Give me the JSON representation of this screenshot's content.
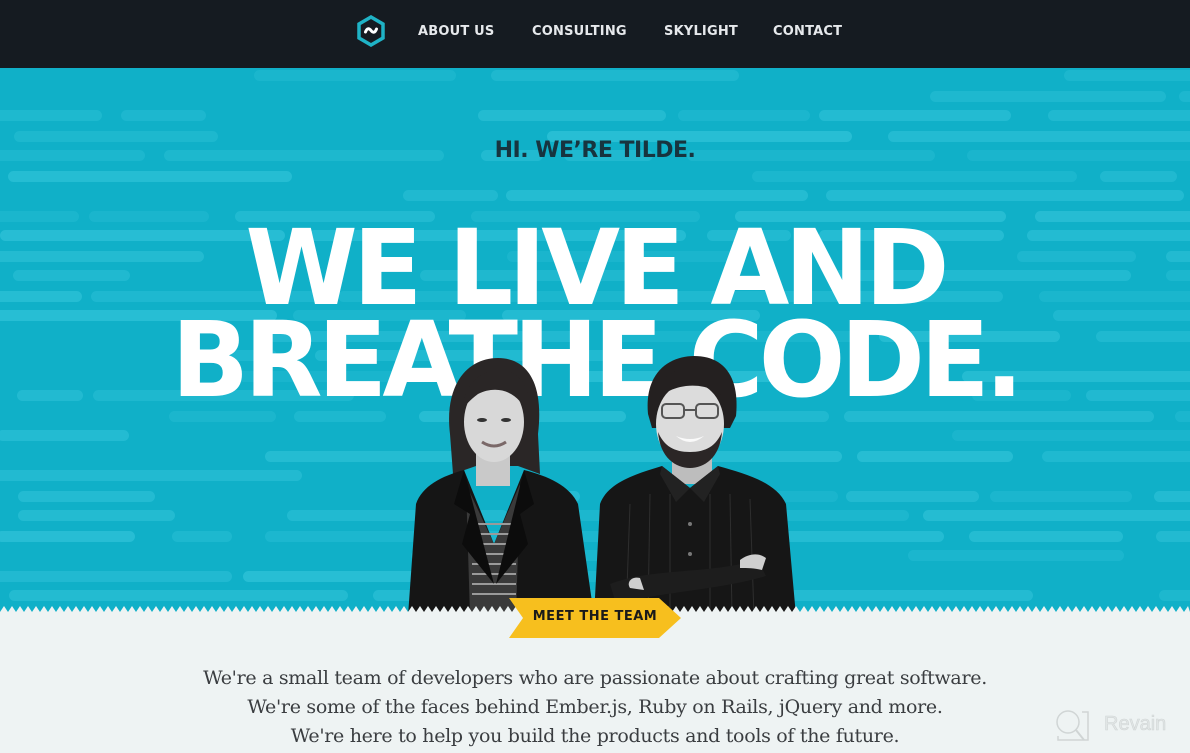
{
  "nav": {
    "logo_icon": "tilde-hexagon-logo-icon",
    "items": [
      {
        "label": "ABOUT US"
      },
      {
        "label": "CONSULTING"
      },
      {
        "label": "SKYLIGHT"
      },
      {
        "label": "CONTACT"
      }
    ]
  },
  "hero": {
    "tagline": "HI. WE’RE TILDE.",
    "headline_line1": "WE LIVE AND",
    "headline_line2": "BREATHE CODE.",
    "people_photo": "team-photo",
    "cta_label": "MEET THE TEAM"
  },
  "intro": {
    "lines": [
      "We're a small team of developers who are passionate about crafting great software.",
      "We're some of the faces behind Ember.js, Ruby on Rails, jQuery and more.",
      "We're here to help you build the products and tools of the future."
    ]
  },
  "watermark": {
    "icon": "revain-logo-icon",
    "text": "Revain"
  },
  "colors": {
    "nav_bg": "#151b21",
    "hero_bg": "#10b0c8",
    "cta_yellow": "#f7bf1e",
    "page_bg": "#eef3f3"
  }
}
